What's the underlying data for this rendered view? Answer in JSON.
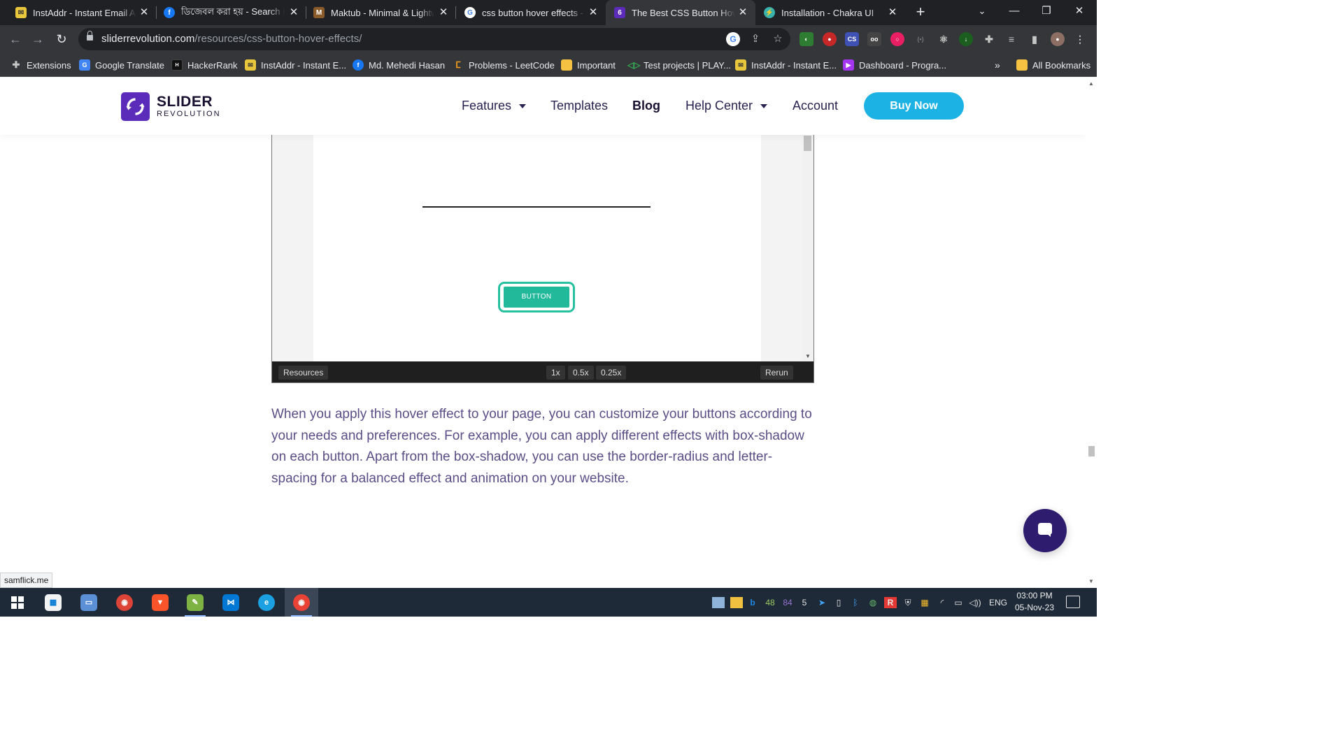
{
  "browser": {
    "tabs": [
      {
        "title": "InstAddr - Instant Email Ad",
        "icon": "instaddr-icon",
        "color": "#e8c73c"
      },
      {
        "title": "ডিজেবল করা হয় - Search F",
        "icon": "facebook-icon",
        "color": "#1877f2"
      },
      {
        "title": "Maktub - Minimal & Lightw",
        "icon": "maktub-icon",
        "color": "#8b5a2b"
      },
      {
        "title": "css button hover effects - G",
        "icon": "google-icon",
        "color": "#ffffff"
      },
      {
        "title": "The Best CSS Button Hover",
        "icon": "sliderrevolution-icon",
        "color": "#5b2bba"
      },
      {
        "title": "Installation - Chakra UI",
        "icon": "chakra-icon",
        "color": "#38b2ac"
      }
    ],
    "active_tab_index": 4,
    "url_domain": "sliderrevolution.com",
    "url_path": "/resources/css-button-hover-effects/",
    "bookmarks": [
      {
        "label": "Extensions",
        "icon": "puzzle-icon",
        "color": "#9aa0a6"
      },
      {
        "label": "Google Translate",
        "icon": "translate-icon",
        "color": "#4285f4"
      },
      {
        "label": "HackerRank",
        "icon": "hackerrank-icon",
        "color": "#111111"
      },
      {
        "label": "InstAddr - Instant E...",
        "icon": "instaddr-icon",
        "color": "#e8c73c"
      },
      {
        "label": "Md. Mehedi Hasan",
        "icon": "facebook-icon",
        "color": "#1877f2"
      },
      {
        "label": "Problems - LeetCode",
        "icon": "leetcode-icon",
        "color": "#f89f1b"
      },
      {
        "label": "Important",
        "icon": "folder-icon",
        "color": "#f5c242"
      },
      {
        "label": "Test projects | PLAY...",
        "icon": "play-icon",
        "color": "#34a853"
      },
      {
        "label": "InstAddr - Instant E...",
        "icon": "instaddr-icon",
        "color": "#e8c73c"
      },
      {
        "label": "Dashboard - Progra...",
        "icon": "dashboard-icon",
        "color": "#a435f0"
      }
    ],
    "bookmarks_overflow": "»",
    "all_bookmarks": "All Bookmarks",
    "status_url": "samflick.me"
  },
  "site": {
    "logo_line1": "SLIDER",
    "logo_line2": "REVOLUTION",
    "nav": {
      "features": "Features",
      "templates": "Templates",
      "blog": "Blog",
      "help_center": "Help Center",
      "account": "Account"
    },
    "buy_now": "Buy Now",
    "brand_color": "#5b2bba",
    "cta_color": "#1cb2e4"
  },
  "demo": {
    "button_label": "BUTTON",
    "resources": "Resources",
    "zoom_1x": "1x",
    "zoom_05x": "0.5x",
    "zoom_025x": "0.25x",
    "rerun": "Rerun",
    "accent_color": "#22b89a"
  },
  "article": {
    "paragraph": "When you apply this hover effect to your page, you can customize your buttons according to your needs and preferences. For example, you can apply different effects with box-shadow on each button. Apart from the box-shadow, you can use the border-radius and letter-spacing for a balanced effect and animation on your website."
  },
  "taskbar": {
    "tray_numbers": [
      "48",
      "84",
      "5"
    ],
    "language": "ENG",
    "time": "03:00 PM",
    "date": "05-Nov-23"
  }
}
